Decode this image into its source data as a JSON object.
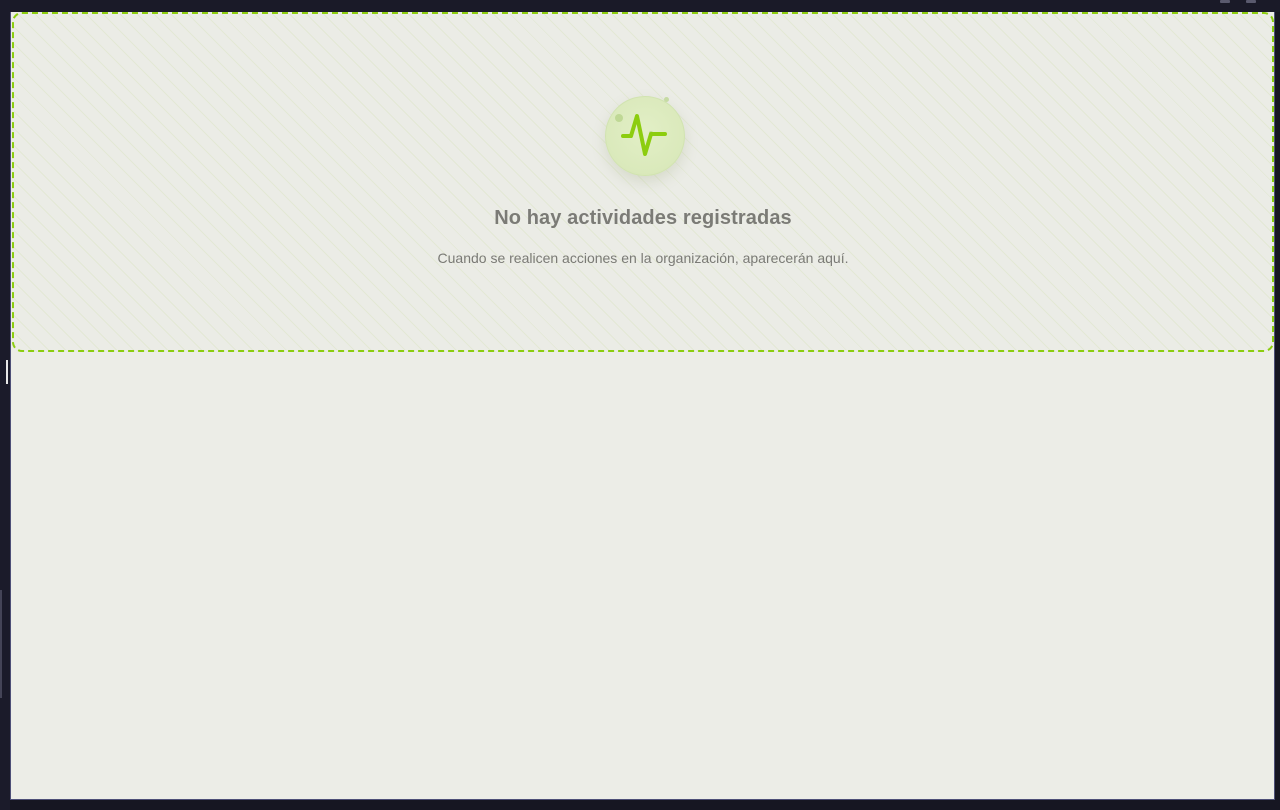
{
  "empty_state": {
    "title": "No hay actividades registradas",
    "message": "Cuando se realicen acciones en la organización, aparecerán aquí.",
    "icon": "activity-pulse-icon",
    "accent_color": "#8ccd0f"
  },
  "colors": {
    "panel_background": "#ecede7",
    "frame_background": "#161622",
    "text_muted": "#7b7b76"
  }
}
